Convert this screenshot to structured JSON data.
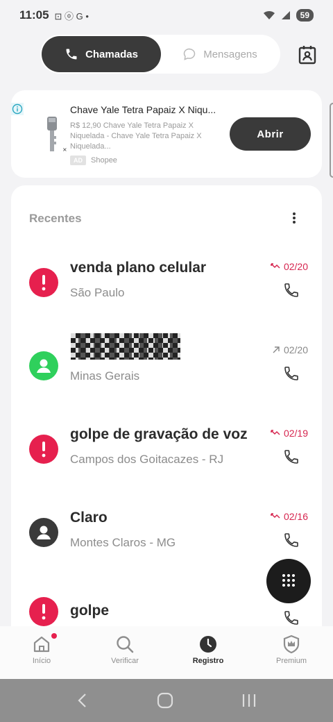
{
  "status": {
    "time": "11:05",
    "battery": "59",
    "left_icons": "⊡ ⓞ G •"
  },
  "tabs": {
    "calls": "Chamadas",
    "messages": "Mensagens"
  },
  "ad": {
    "title": "Chave Yale Tetra Papaiz X Niqu...",
    "description": "R$ 12,90 Chave Yale Tetra Papaiz X Niquelada - Chave Yale Tetra Papaiz X Niquelada...",
    "badge": "AD",
    "advertiser": "Shopee",
    "button": "Abrir"
  },
  "recents": {
    "title": "Recentes",
    "calls": [
      {
        "name": "venda plano celular",
        "location": "São Paulo",
        "date": "02/20",
        "direction": "missed",
        "avatar": "spam"
      },
      {
        "name": "",
        "location": "Minas Gerais",
        "date": "02/20",
        "direction": "outgoing",
        "avatar": "contact"
      },
      {
        "name": "golpe de gravação de voz",
        "location": "Campos dos Goitacazes - RJ",
        "date": "02/19",
        "direction": "missed",
        "avatar": "spam"
      },
      {
        "name": "Claro",
        "location": "Montes Claros - MG",
        "date": "02/16",
        "direction": "missed",
        "avatar": "unknown"
      },
      {
        "name": "golpe",
        "location": "",
        "date": "",
        "direction": "missed",
        "avatar": "spam"
      }
    ]
  },
  "nav": {
    "home": "Início",
    "verify": "Verificar",
    "log": "Registro",
    "premium": "Premium"
  },
  "colors": {
    "accent_dark": "#3a3a3a",
    "spam_red": "#e6204e",
    "ok_green": "#2fd05c"
  }
}
